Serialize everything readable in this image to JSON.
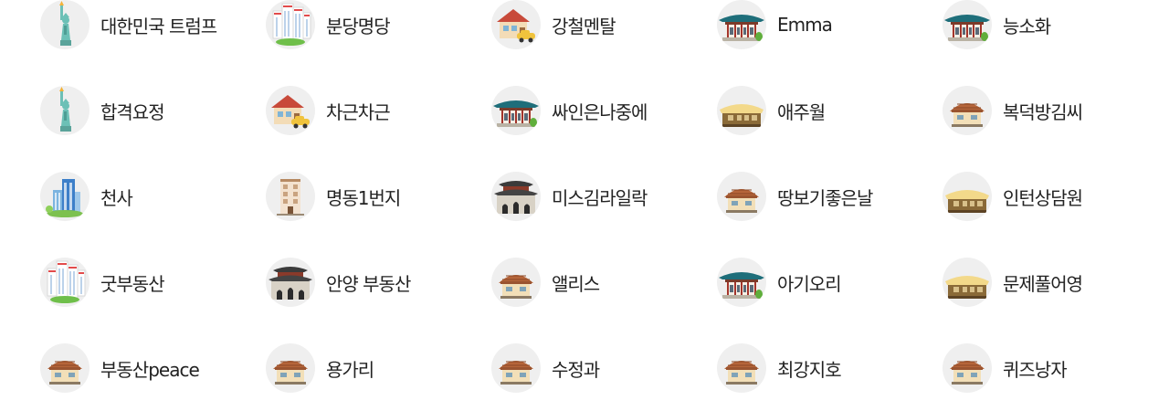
{
  "users": [
    {
      "name": "대한민국 트럼프",
      "icon": "statue-of-liberty-icon"
    },
    {
      "name": "분당명당",
      "icon": "apartment-complex-icon"
    },
    {
      "name": "강철멘탈",
      "icon": "house-with-car-icon"
    },
    {
      "name": "Emma",
      "icon": "hanok-palace-icon"
    },
    {
      "name": "능소화",
      "icon": "hanok-palace-icon"
    },
    {
      "name": "합격요정",
      "icon": "statue-of-liberty-icon"
    },
    {
      "name": "차근차근",
      "icon": "house-with-car-icon"
    },
    {
      "name": "싸인은나중에",
      "icon": "hanok-palace-icon"
    },
    {
      "name": "애주월",
      "icon": "thatched-hut-icon"
    },
    {
      "name": "복덕방김씨",
      "icon": "tiled-cottage-icon"
    },
    {
      "name": "천사",
      "icon": "office-tower-icon"
    },
    {
      "name": "명동1번지",
      "icon": "brick-building-icon"
    },
    {
      "name": "미스김라일락",
      "icon": "city-gate-icon"
    },
    {
      "name": "땅보기좋은날",
      "icon": "tiled-cottage-icon"
    },
    {
      "name": "인턴상담원",
      "icon": "thatched-hut-icon"
    },
    {
      "name": "굿부동산",
      "icon": "apartment-complex-icon"
    },
    {
      "name": "안양 부동산",
      "icon": "city-gate-icon"
    },
    {
      "name": "앨리스",
      "icon": "tiled-cottage-icon"
    },
    {
      "name": "아기오리",
      "icon": "hanok-palace-icon"
    },
    {
      "name": "문제풀어영",
      "icon": "thatched-hut-icon"
    },
    {
      "name": "부동산peace",
      "icon": "tiled-cottage-icon"
    },
    {
      "name": "용가리",
      "icon": "tiled-cottage-icon"
    },
    {
      "name": "수정과",
      "icon": "tiled-cottage-icon"
    },
    {
      "name": "최강지호",
      "icon": "tiled-cottage-icon"
    },
    {
      "name": "퀴즈낭자",
      "icon": "tiled-cottage-icon"
    }
  ]
}
